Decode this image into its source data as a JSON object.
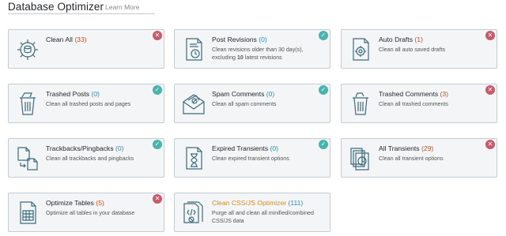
{
  "header": {
    "title": "Database Optimizer",
    "learn_more": "Learn More"
  },
  "colors": {
    "bad": "#c75a6b",
    "good": "#4ab3ad",
    "highlight": "#dc8c16",
    "count_warn": "#ca4a1f",
    "count_ok": "#2e8fb4"
  },
  "cards": [
    {
      "title": "Clean All",
      "count": "(33)",
      "desc": "",
      "status": "bad",
      "icon": "gear-db-icon"
    },
    {
      "title": "Post Revisions",
      "count": "(0)",
      "desc_pre": "Clean revisions older than 30 day(s), excluding ",
      "desc_bold": "10",
      "desc_post": " latest revisions",
      "status": "good",
      "icon": "revision-document-icon"
    },
    {
      "title": "Auto Drafts",
      "count": "(1)",
      "desc": "Clean all auto saved drafts",
      "status": "bad",
      "icon": "draft-document-icon"
    },
    {
      "title": "Trashed Posts",
      "count": "(0)",
      "desc": "Clean all trashed posts and pages",
      "status": "good",
      "icon": "trash-posts-icon"
    },
    {
      "title": "Spam Comments",
      "count": "(0)",
      "desc": "Clean all spam comments",
      "status": "good",
      "icon": "spam-envelope-icon"
    },
    {
      "title": "Trashed Comments",
      "count": "(3)",
      "desc": "Clean all trashed comments",
      "status": "bad",
      "icon": "trash-comments-icon"
    },
    {
      "title": "Trackbacks/Pingbacks",
      "count": "(0)",
      "desc": "Clean all trackbacks and pingbacks",
      "status": "good",
      "icon": "trackback-pages-icon"
    },
    {
      "title": "Expired Transients",
      "count": "(0)",
      "desc": "Clean expired transient options",
      "status": "good",
      "icon": "hourglass-document-icon"
    },
    {
      "title": "All Transients",
      "count": "(29)",
      "desc": "Clean all transient options",
      "status": "bad",
      "icon": "stacked-clock-icon"
    },
    {
      "title": "Optimize Tables",
      "count": "(5)",
      "desc": "Optimize all tables in your database",
      "status": "bad",
      "icon": "table-document-icon"
    },
    {
      "title": "Clean CSS/JS Optimizer",
      "count": "(111)",
      "desc": "Purge all and clean all minified/combined CSS/JS data",
      "status": "none",
      "icon": "code-document-icon"
    }
  ]
}
